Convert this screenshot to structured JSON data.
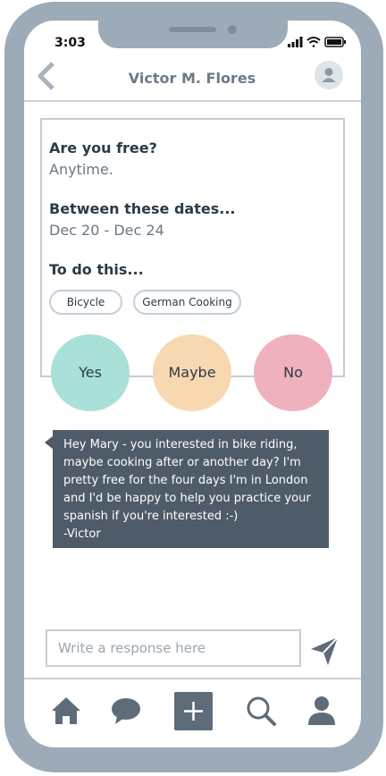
{
  "status_bar": {
    "time": "3:03"
  },
  "header": {
    "contact_name": "Victor M. Flores"
  },
  "invite": {
    "q1_label": "Are you free?",
    "q1_value": "Anytime.",
    "q2_label": "Between these dates...",
    "q2_value": "Dec 20 - Dec 24",
    "q3_label": "To do this...",
    "tags": [
      "Bicycle",
      "German Cooking"
    ]
  },
  "responses": [
    {
      "label": "Yes",
      "color": "#a9e0d8"
    },
    {
      "label": "Maybe",
      "color": "#f8d8b0"
    },
    {
      "label": "No",
      "color": "#eeb1bd"
    }
  ],
  "message": {
    "lines": [
      "Hey Mary - you interested in bike riding,",
      "maybe cooking after or another day? I'm",
      "pretty free for the four days I'm in London",
      "and I'd be happy to help you practice your",
      "spanish if you're interested :-)",
      "-Victor"
    ]
  },
  "reply": {
    "placeholder": "Write a response here"
  },
  "nav": [
    "home-icon",
    "chat-icon",
    "plus-icon",
    "search-icon",
    "profile-icon"
  ],
  "colors": {
    "frame": "#9dabb8",
    "accent": "#5e6c79",
    "border": "#c5ced7"
  }
}
